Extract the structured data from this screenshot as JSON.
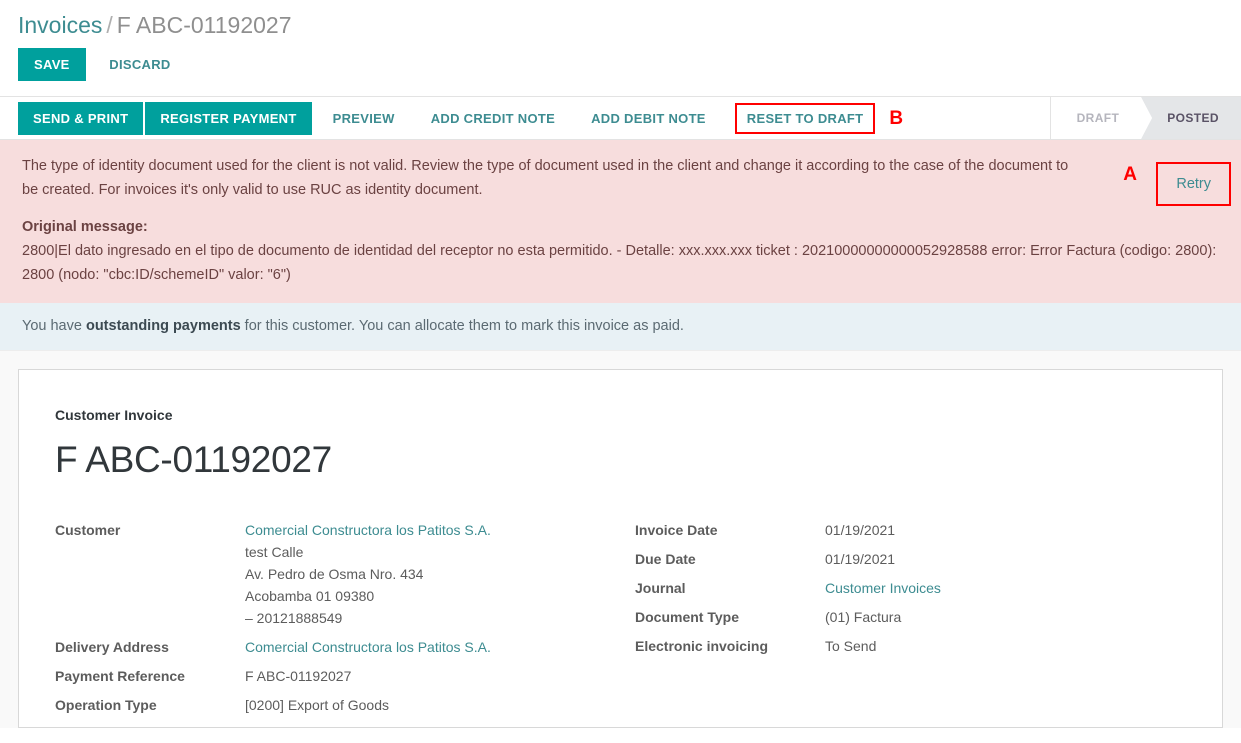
{
  "breadcrumb": {
    "root": "Invoices",
    "separator": "/",
    "current": "F ABC-01192027"
  },
  "edit_bar": {
    "save_label": "SAVE",
    "discard_label": "DISCARD"
  },
  "action_bar": {
    "buttons": [
      {
        "label": "SEND & PRINT",
        "style": "primary"
      },
      {
        "label": "REGISTER PAYMENT",
        "style": "primary"
      },
      {
        "label": "PREVIEW",
        "style": "link"
      },
      {
        "label": "ADD CREDIT NOTE",
        "style": "link"
      },
      {
        "label": "ADD DEBIT NOTE",
        "style": "link"
      },
      {
        "label": "RESET TO DRAFT",
        "style": "link-annotated"
      }
    ],
    "annotation_b": "B"
  },
  "statusbar": {
    "stages": [
      {
        "label": "DRAFT",
        "active": false
      },
      {
        "label": "POSTED",
        "active": true
      }
    ]
  },
  "alert_error": {
    "message": "The type of identity document used for the client is not valid. Review the type of document used in the client and change it according to the case of the document to be created. For invoices it's only valid to use RUC as identity document.",
    "original_label": "Original message:",
    "original_body": "2800|El dato ingresado en el tipo de documento de identidad del receptor no esta permitido. - Detalle: xxx.xxx.xxx ticket : 20210000000000052928588 error: Error Factura (codigo: 2800): 2800 (nodo: \"cbc:ID/schemeID\" valor: \"6\")",
    "retry_label": "Retry",
    "annotation_a": "A"
  },
  "alert_info": {
    "prefix": "You have ",
    "bold": "outstanding payments",
    "suffix": " for this customer. You can allocate them to mark this invoice as paid."
  },
  "sheet": {
    "subtitle": "Customer Invoice",
    "title": "F ABC-01192027",
    "left_fields": [
      {
        "label": "Customer",
        "lines": [
          {
            "text": "Comercial Constructora los Patitos S.A.",
            "link": true
          },
          {
            "text": "test Calle",
            "link": false
          },
          {
            "text": "Av. Pedro de Osma Nro. 434",
            "link": false
          },
          {
            "text": "Acobamba 01 09380",
            "link": false
          },
          {
            "text": "– 20121888549",
            "link": false
          }
        ]
      },
      {
        "label": "Delivery Address",
        "lines": [
          {
            "text": "Comercial Constructora los Patitos S.A.",
            "link": true
          }
        ]
      },
      {
        "label": "Payment Reference",
        "lines": [
          {
            "text": "F ABC-01192027",
            "link": false
          }
        ]
      },
      {
        "label": "Operation Type",
        "lines": [
          {
            "text": "[0200] Export of Goods",
            "link": false
          }
        ]
      }
    ],
    "right_fields": [
      {
        "label": "Invoice Date",
        "value": "01/19/2021",
        "link": false
      },
      {
        "label": "Due Date",
        "value": "01/19/2021",
        "link": false
      },
      {
        "label": "Journal",
        "value": "Customer Invoices",
        "link": true
      },
      {
        "label": "Document Type",
        "value": "(01) Factura",
        "link": false
      },
      {
        "label": "Electronic invoicing",
        "value": "To Send",
        "link": false
      }
    ]
  },
  "colors": {
    "accent_teal": "#00a09d",
    "link_teal": "#3d8c91",
    "alert_error_bg": "#f7dddd",
    "alert_info_bg": "#e8f1f5",
    "annotation_red": "#ff0000",
    "status_active_bg": "#e4e6e8"
  }
}
